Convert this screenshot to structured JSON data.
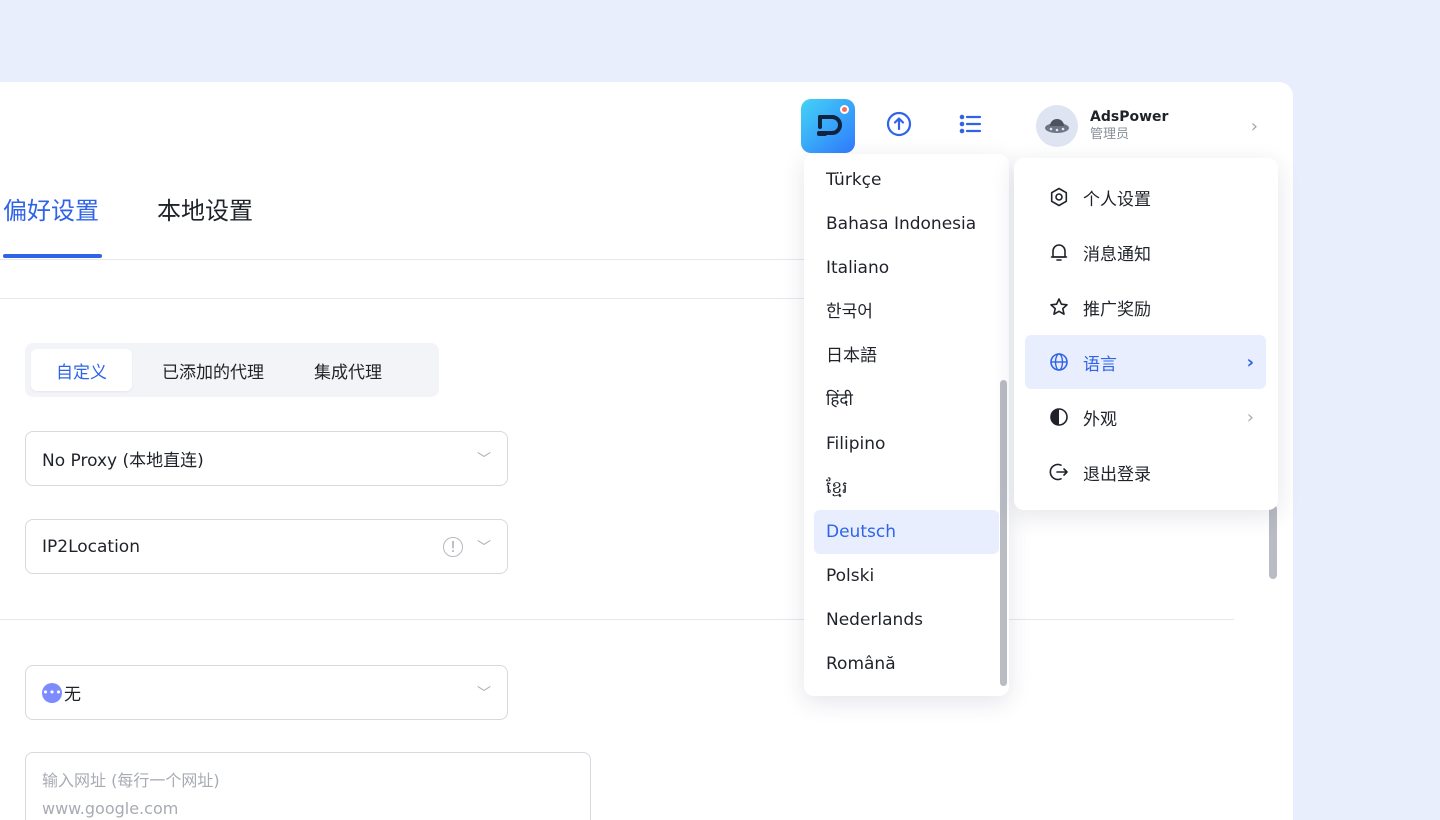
{
  "topbar": {
    "profile_name": "AdsPower",
    "profile_role": "管理员"
  },
  "tabs": [
    {
      "label": "偏好设置",
      "active": true
    },
    {
      "label": "本地设置",
      "active": false
    }
  ],
  "proxy_segment": [
    {
      "label": "自定义",
      "active": true
    },
    {
      "label": "已添加的代理",
      "active": false
    },
    {
      "label": "集成代理",
      "active": false
    }
  ],
  "fields": {
    "proxy_select": "No Proxy (本地直连)",
    "ip_lookup_select": "IP2Location",
    "extension_select": "无",
    "url_textarea_placeholder_line1": "输入网址 (每行一个网址)",
    "url_textarea_placeholder_line2": "www.google.com"
  },
  "language_menu": [
    {
      "label": "Türkçe",
      "active": false
    },
    {
      "label": "Bahasa Indonesia",
      "active": false
    },
    {
      "label": "Italiano",
      "active": false
    },
    {
      "label": "한국어",
      "active": false
    },
    {
      "label": "日本語",
      "active": false
    },
    {
      "label": "हिंदी",
      "active": false
    },
    {
      "label": "Filipino",
      "active": false
    },
    {
      "label": "ខ្មែរ",
      "active": false
    },
    {
      "label": "Deutsch",
      "active": true
    },
    {
      "label": "Polski",
      "active": false
    },
    {
      "label": "Nederlands",
      "active": false
    },
    {
      "label": "Română",
      "active": false
    }
  ],
  "user_menu": [
    {
      "label": "个人设置",
      "icon": "gear-icon",
      "has_arrow": false,
      "active": false
    },
    {
      "label": "消息通知",
      "icon": "bell-icon",
      "has_arrow": false,
      "active": false
    },
    {
      "label": "推广奖励",
      "icon": "star-icon",
      "has_arrow": false,
      "active": false
    },
    {
      "label": "语言",
      "icon": "globe-icon",
      "has_arrow": true,
      "active": true
    },
    {
      "label": "外观",
      "icon": "contrast-icon",
      "has_arrow": true,
      "active": false
    },
    {
      "label": "退出登录",
      "icon": "logout-icon",
      "has_arrow": false,
      "active": false
    }
  ],
  "colors": {
    "accent": "#2f63e8",
    "page_background": "#e8eefc",
    "active_item_background": "#e8eefe"
  }
}
